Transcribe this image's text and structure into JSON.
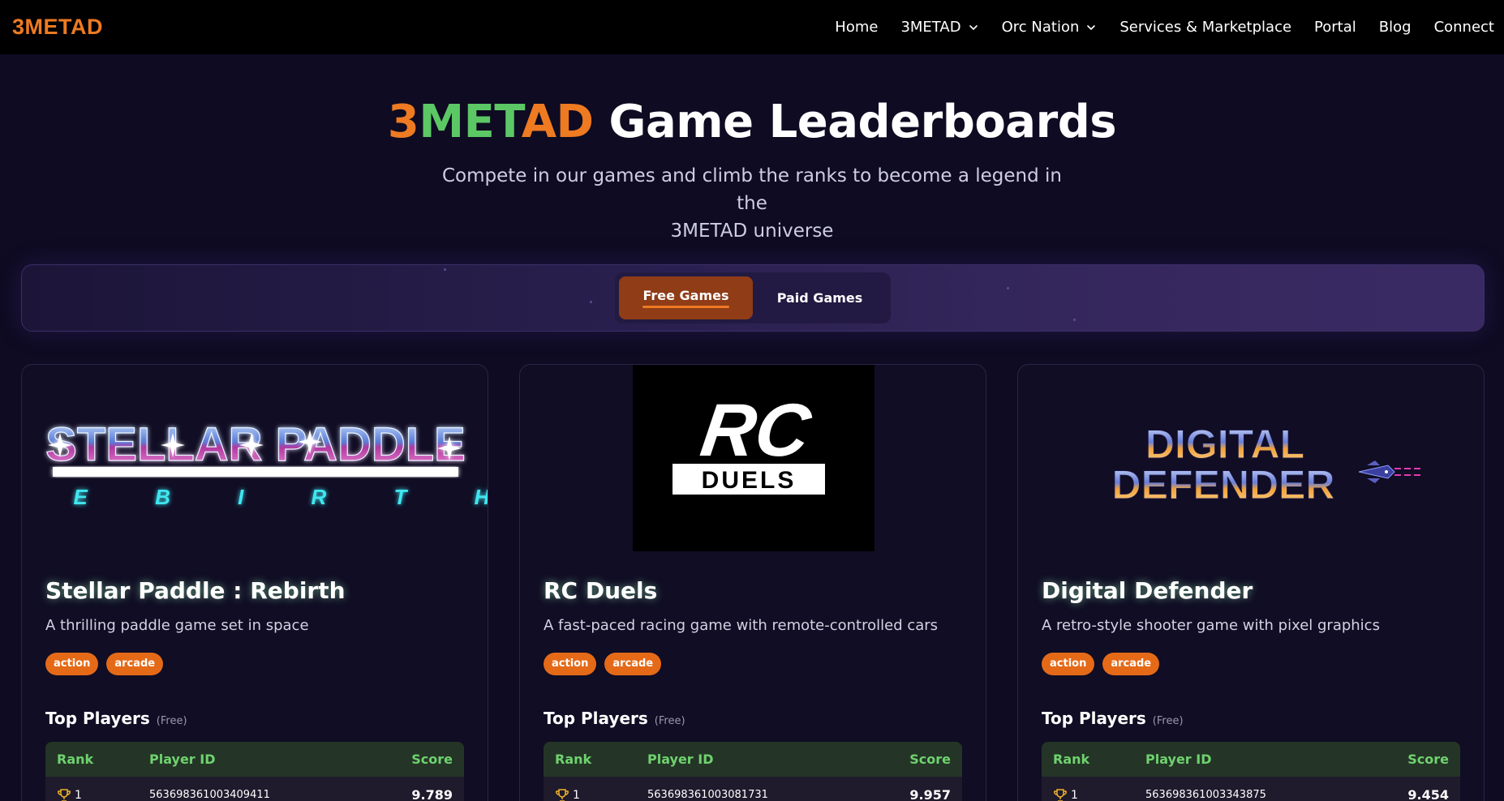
{
  "brand": {
    "part1": "3MET",
    "part2": "AD"
  },
  "nav": {
    "items": [
      {
        "label": "Home",
        "has_dropdown": false
      },
      {
        "label": "3METAD",
        "has_dropdown": true
      },
      {
        "label": "Orc Nation",
        "has_dropdown": true
      },
      {
        "label": "Services & Marketplace",
        "has_dropdown": false
      },
      {
        "label": "Portal",
        "has_dropdown": false
      },
      {
        "label": "Blog",
        "has_dropdown": false
      },
      {
        "label": "Connect",
        "has_dropdown": false
      }
    ]
  },
  "hero": {
    "title_part1": "3",
    "title_part2": "MET",
    "title_part3": "AD",
    "title_part4": " Game Leaderboards",
    "subtitle_line1": "Compete in our games and climb the ranks to become a legend in the",
    "subtitle_line2": "3METAD universe"
  },
  "tabs": {
    "free_label": "Free Games",
    "paid_label": "Paid Games",
    "active": "free"
  },
  "cards": [
    {
      "title": "Stellar Paddle : Rebirth",
      "description": "A thrilling paddle game set in space",
      "logo_line1": "STELLAR PADDLE",
      "logo_line2": "R E B I R T H",
      "tags": [
        "action",
        "arcade"
      ],
      "top_players_label": "Top Players",
      "top_players_note": "(Free)",
      "columns": [
        "Rank",
        "Player ID",
        "Score"
      ],
      "rows": [
        {
          "rank": "1",
          "player_id": "563698361003409411",
          "score": "9.789"
        }
      ]
    },
    {
      "title": "RC Duels",
      "description": "A fast-paced racing game with remote-controlled cars",
      "logo_line1": "RC",
      "logo_line2": "DUELS",
      "tags": [
        "action",
        "arcade"
      ],
      "top_players_label": "Top Players",
      "top_players_note": "(Free)",
      "columns": [
        "Rank",
        "Player ID",
        "Score"
      ],
      "rows": [
        {
          "rank": "1",
          "player_id": "563698361003081731",
          "score": "9.957"
        }
      ]
    },
    {
      "title": "Digital Defender",
      "description": "A retro-style shooter game with pixel graphics",
      "logo_line1": "DIGITAL",
      "logo_line2": "DEFENDER",
      "tags": [
        "action",
        "arcade"
      ],
      "top_players_label": "Top Players",
      "top_players_note": "(Free)",
      "columns": [
        "Rank",
        "Player ID",
        "Score"
      ],
      "rows": [
        {
          "rank": "1",
          "player_id": "563698361003343875",
          "score": "9.454"
        }
      ]
    }
  ],
  "colors": {
    "brand_orange": "#ee7a22",
    "brand_green": "#5cc765",
    "tag_orange": "#e46a18",
    "leaderboard_header_text": "#6fd26e",
    "background": "#0e0b22"
  },
  "icons": {
    "dropdown": "chevron-down-icon",
    "rank_first": "trophy-icon"
  }
}
